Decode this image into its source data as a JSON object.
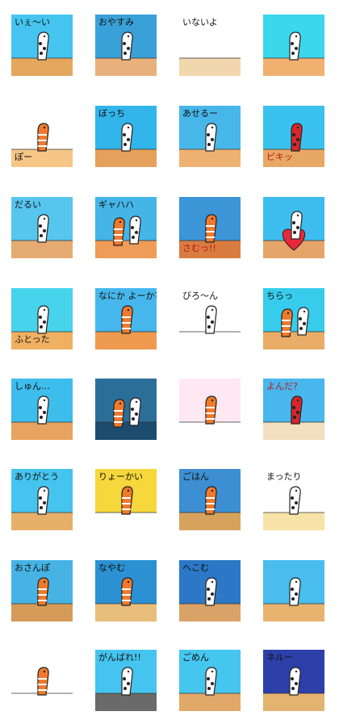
{
  "title": "",
  "stickers": [
    {
      "caption": "いぇ〜い",
      "top": "#45c4ef",
      "bottom": "#e3a85e",
      "char": "white"
    },
    {
      "caption": "おやすみ",
      "top": "#3aa1d8",
      "bottom": "#e8b07c",
      "char": "white"
    },
    {
      "caption": "いないよ",
      "top": "#ffffff",
      "bottom": "#f1d7ad",
      "char": "none"
    },
    {
      "caption": "",
      "top": "#3bd7ea",
      "bottom": "#f0b070",
      "char": "white"
    },
    {
      "caption": "ぽー",
      "top": "#ffffff",
      "bottom": "#f5c685",
      "char": "orange"
    },
    {
      "caption": "ぼっち",
      "top": "#32b5ea",
      "bottom": "#e5a05b",
      "char": "white"
    },
    {
      "caption": "あせるー",
      "top": "#47b7ea",
      "bottom": "#edb271",
      "char": "white"
    },
    {
      "caption": "ピキッ",
      "top": "#3bc1ee",
      "bottom": "#e8a865",
      "char": "red"
    },
    {
      "caption": "だるい",
      "top": "#56c6ef",
      "bottom": "#e6ab72",
      "char": "white"
    },
    {
      "caption": "ギャハハ",
      "top": "#44b5e6",
      "bottom": "#ee9c58",
      "char": "pair"
    },
    {
      "caption": "さむっ!!",
      "top": "#3c95d7",
      "bottom": "#d87c3f",
      "char": "orange"
    },
    {
      "caption": "",
      "top": "#3dbdee",
      "bottom": "#e5a569",
      "char": "heart"
    },
    {
      "caption": "ふとった",
      "top": "#47d3ec",
      "bottom": "#efb062",
      "char": "white"
    },
    {
      "caption": "なにか よーか?",
      "top": "#46b7ec",
      "bottom": "#ee9a4f",
      "char": "orange"
    },
    {
      "caption": "びろ〜ん",
      "top": "#ffffff",
      "bottom": "#ffffff",
      "char": "white"
    },
    {
      "caption": "ちらっ",
      "top": "#37ccec",
      "bottom": "#e9ad67",
      "char": "pair"
    },
    {
      "caption": "しゅん…",
      "top": "#3dbdec",
      "bottom": "#e7a35f",
      "char": "white"
    },
    {
      "caption": "",
      "top": "#2b6f99",
      "bottom": "#1b4c6e",
      "char": "pair"
    },
    {
      "caption": "",
      "top": "#fee8f2",
      "bottom": "#ffffff",
      "char": "orange"
    },
    {
      "caption": "よんだ?",
      "top": "#48b7ed",
      "bottom": "#f2dfc0",
      "char": "red"
    },
    {
      "caption": "ありがとう",
      "top": "#45c4ef",
      "bottom": "#e6b069",
      "char": "white"
    },
    {
      "caption": "りょーかい",
      "top": "#f6d73c",
      "bottom": "#ffffff",
      "char": "orange"
    },
    {
      "caption": "ごはん",
      "top": "#3c8fd2",
      "bottom": "#d7a35c",
      "char": "orange"
    },
    {
      "caption": "まったり",
      "top": "#ffffff",
      "bottom": "#f7e3a8",
      "char": "white"
    },
    {
      "caption": "おさんぽ",
      "top": "#46b3e4",
      "bottom": "#d69b58",
      "char": "orange"
    },
    {
      "caption": "なやむ",
      "top": "#2b91d3",
      "bottom": "#e9bd7a",
      "char": "orange"
    },
    {
      "caption": "へこむ",
      "top": "#2d78c6",
      "bottom": "#d9a368",
      "char": "white"
    },
    {
      "caption": "",
      "top": "#49bdee",
      "bottom": "#e8b36f",
      "char": "white"
    },
    {
      "caption": "",
      "top": "#ffffff",
      "bottom": "#ffffff",
      "char": "orange"
    },
    {
      "caption": "がんばれ!!",
      "top": "#45c4ef",
      "bottom": "#6a6a6a",
      "char": "white"
    },
    {
      "caption": "ごめん",
      "top": "#45c6ee",
      "bottom": "#e1a86a",
      "char": "white"
    },
    {
      "caption": "ネルー",
      "top": "#2d3fa8",
      "bottom": "#e3b370",
      "char": "white"
    }
  ]
}
